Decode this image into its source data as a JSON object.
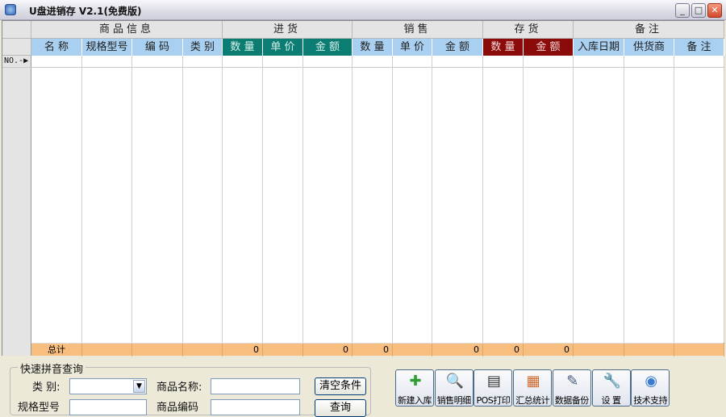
{
  "window": {
    "title": "U盘进销存 V2.1(免费版)",
    "min": "_",
    "max": "□",
    "close": "✕"
  },
  "grid": {
    "groups": [
      "商品信息",
      "进货",
      "销售",
      "存货",
      "备注"
    ],
    "columns": [
      "名 称",
      "规格型号",
      "编 码",
      "类 别",
      "数 量",
      "单 价",
      "金 额",
      "数 量",
      "单 价",
      "金 额",
      "数 量",
      "金 额",
      "入库日期",
      "供货商",
      "备 注"
    ],
    "row_indicator": "NO.-▶",
    "total_label": "总计",
    "totals": [
      "",
      "",
      "",
      "",
      "0",
      "",
      "0",
      "0",
      "",
      "0",
      "0",
      "0",
      "",
      "",
      ""
    ]
  },
  "search": {
    "legend": "快速拼音查询",
    "category_label": "类 别:",
    "category_value": "",
    "name_label": "商品名称:",
    "name_value": "",
    "clear_button": "清空条件",
    "spec_label": "规格型号",
    "code_label": "商品编码",
    "query_button": "查询"
  },
  "toolbar": [
    {
      "label": "新建入库",
      "icon": "plus-icon"
    },
    {
      "label": "销售明细",
      "icon": "magnifier-icon"
    },
    {
      "label": "POS打印",
      "icon": "printer-icon"
    },
    {
      "label": "汇总统计",
      "icon": "calendar-icon"
    },
    {
      "label": "数据备份",
      "icon": "floppy-icon"
    },
    {
      "label": "设 置",
      "icon": "wrench-icon"
    },
    {
      "label": "技术支持",
      "icon": "globe-icon"
    }
  ],
  "colors": {
    "teal": "#0c7d72",
    "darkred": "#8b0a0a",
    "header_blue": "#a9d0f0",
    "total_orange": "#f7be80"
  }
}
